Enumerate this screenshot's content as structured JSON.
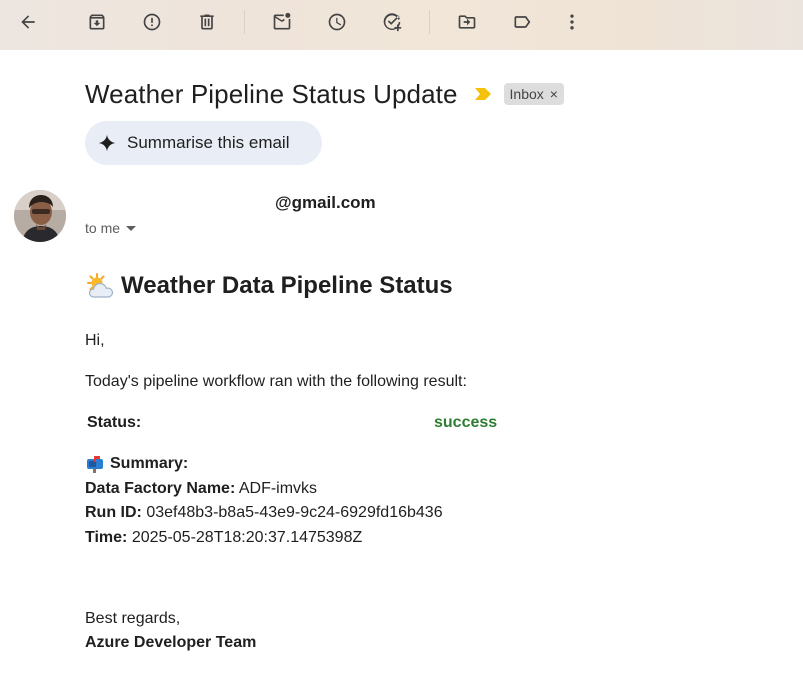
{
  "toolbar": {
    "buttons": [
      {
        "icon": "back-arrow-icon"
      },
      {
        "icon": "archive-icon"
      },
      {
        "icon": "report-spam-icon"
      },
      {
        "icon": "delete-icon"
      },
      {
        "icon": "mark-unread-icon"
      },
      {
        "icon": "snooze-icon"
      },
      {
        "icon": "add-task-icon"
      },
      {
        "icon": "move-to-icon"
      },
      {
        "icon": "label-icon"
      },
      {
        "icon": "more-options-icon"
      }
    ]
  },
  "email": {
    "subject": "Weather Pipeline Status Update",
    "label_chip": "Inbox",
    "label_chip_close": "×",
    "summarise_label": "Summarise this email",
    "sender_email": "@gmail.com",
    "recipient": "to me"
  },
  "message": {
    "title": "Weather Data Pipeline Status",
    "greeting": "Hi,",
    "intro": "Today's pipeline workflow ran with the following result:",
    "status_label": "Status:",
    "status_value": "success",
    "summary_heading": "Summary:",
    "fields": [
      {
        "label": "Data Factory Name:",
        "value": "ADF-imvks"
      },
      {
        "label": "Run ID:",
        "value": "03ef48b3-b8a5-43e9-9c24-6929fd16b436"
      },
      {
        "label": "Time:",
        "value": "2025-05-28T18:20:37.1475398Z"
      }
    ],
    "closing": "Best regards,",
    "signature": "Azure Developer Team"
  },
  "colors": {
    "status_success": "#2e7d32",
    "importance_marker": "#f4c20d",
    "summarise_bg": "#e9eef6",
    "chip_bg": "#dddddd"
  }
}
